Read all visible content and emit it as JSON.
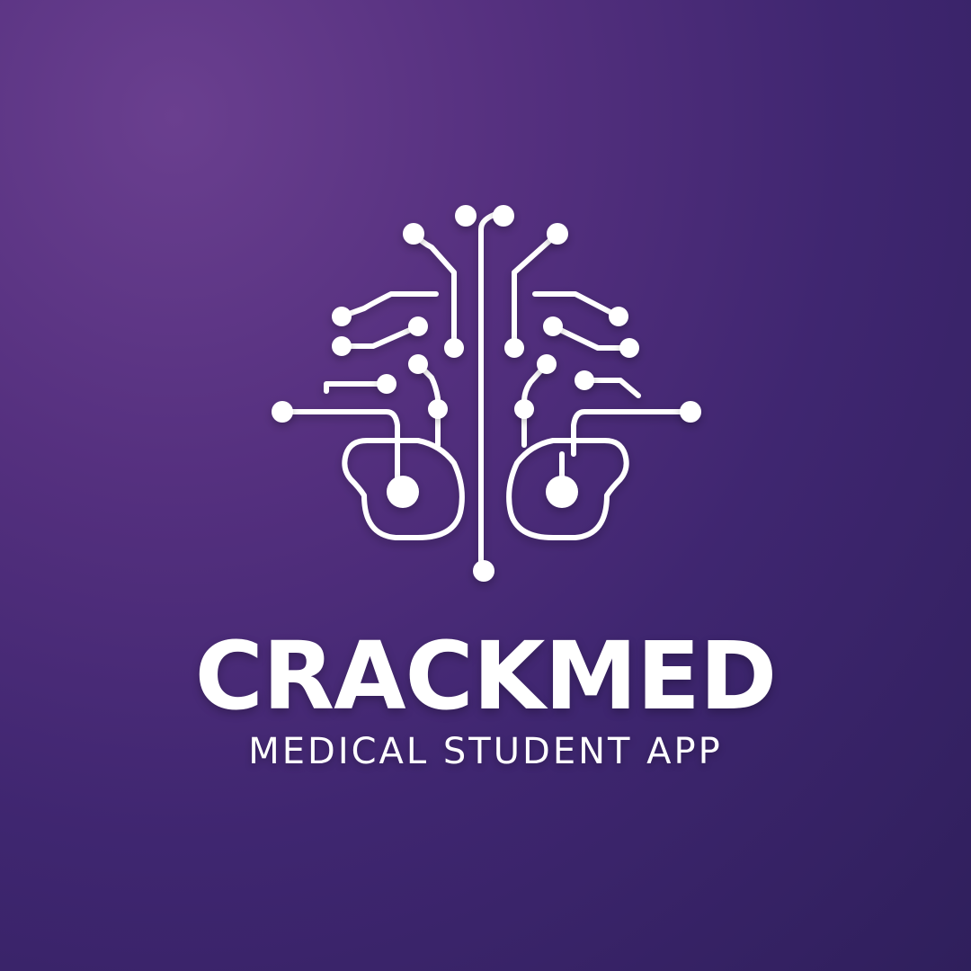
{
  "brand": {
    "name": "CRACKMED",
    "tagline": "MEDICAL STUDENT APP"
  },
  "colors": {
    "background_top": "#6a3f8f",
    "background_bottom": "#2f1f5c",
    "foreground": "#ffffff"
  },
  "icons": {
    "logo": "circuit-brain-icon"
  }
}
